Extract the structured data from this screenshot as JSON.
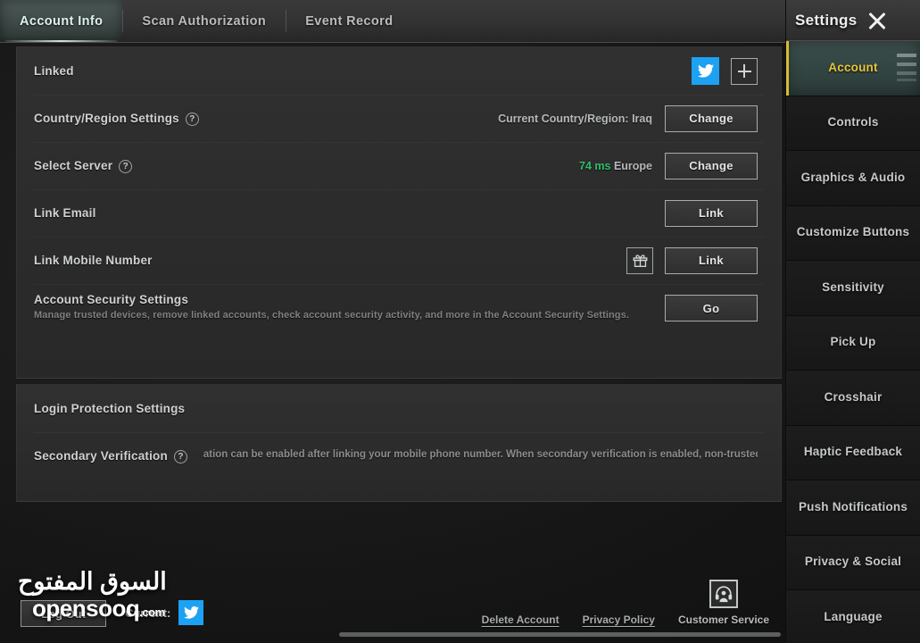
{
  "tabs": [
    {
      "label": "Account Info",
      "active": true
    },
    {
      "label": "Scan Authorization",
      "active": false
    },
    {
      "label": "Event Record",
      "active": false
    }
  ],
  "sidebar": {
    "title": "Settings",
    "close_icon": "close-icon",
    "items": [
      {
        "label": "Account",
        "active": true
      },
      {
        "label": "Controls",
        "active": false
      },
      {
        "label": "Graphics & Audio",
        "active": false
      },
      {
        "label": "Customize Buttons",
        "active": false
      },
      {
        "label": "Sensitivity",
        "active": false
      },
      {
        "label": "Pick Up",
        "active": false
      },
      {
        "label": "Crosshair",
        "active": false
      },
      {
        "label": "Haptic Feedback",
        "active": false
      },
      {
        "label": "Push Notifications",
        "active": false
      },
      {
        "label": "Privacy & Social",
        "active": false
      },
      {
        "label": "Language",
        "active": false
      }
    ]
  },
  "account_card": {
    "linked": {
      "label": "Linked",
      "twitter_icon": "twitter-icon",
      "add_icon": "plus-icon"
    },
    "country_region": {
      "label": "Country/Region Settings",
      "help_icon": "help-icon",
      "value": "Current Country/Region: Iraq",
      "button": "Change"
    },
    "select_server": {
      "label": "Select Server",
      "help_icon": "help-icon",
      "ping": "74 ms",
      "server": "Europe",
      "button": "Change"
    },
    "link_email": {
      "label": "Link Email",
      "button": "Link"
    },
    "link_mobile": {
      "label": "Link Mobile Number",
      "gift_icon": "gift-icon",
      "button": "Link"
    },
    "account_security": {
      "label": "Account Security Settings",
      "description": "Manage trusted devices, remove linked accounts, check account security activity, and more in the Account Security Settings.",
      "button": "Go"
    }
  },
  "login_card": {
    "title": "Login Protection Settings",
    "secondary_verification": {
      "label": "Secondary Verification",
      "help_icon": "help-icon",
      "description": "Secondary verification can be enabled after linking your mobile phone number. When secondary verification is enabled, non-trusted"
    }
  },
  "bottom": {
    "logout_button": "Log Out",
    "current_label": "Current:",
    "current_twitter_icon": "twitter-icon",
    "delete_account_link": "Delete Account",
    "privacy_policy_link": "Privacy Policy",
    "customer_service_link": "Customer Service",
    "customer_service_icon": "customer-service-icon"
  },
  "watermark": {
    "arabic": "السوق المفتوح",
    "english": "opensooq",
    "domain": ".com"
  },
  "colors": {
    "accent_yellow": "#e8c43c",
    "twitter_blue": "#1da1f2",
    "ping_green": "#2fbf6d",
    "panel": "#2e2e2e",
    "background": "#1a1a1a"
  }
}
